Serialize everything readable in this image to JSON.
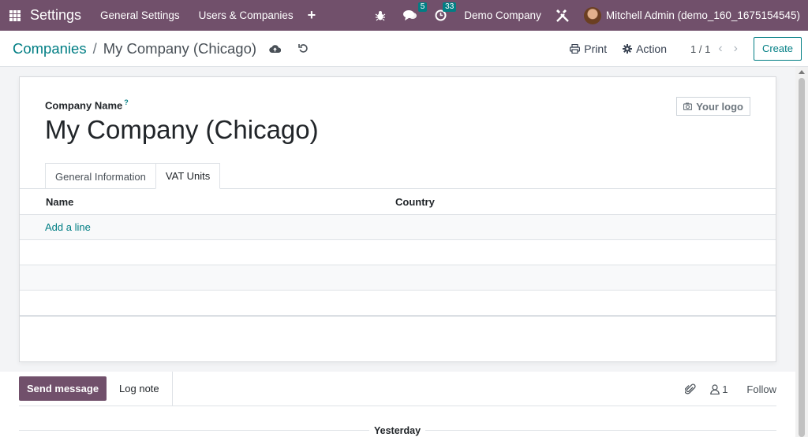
{
  "navbar": {
    "app_name": "Settings",
    "menu": [
      "General Settings",
      "Users & Companies"
    ],
    "plus": "+",
    "messages_count": "5",
    "activities_count": "33",
    "company": "Demo Company",
    "user": "Mitchell Admin (demo_160_1675154545)"
  },
  "control_panel": {
    "breadcrumb_parent": "Companies",
    "breadcrumb_sep": "/",
    "breadcrumb_current": "My Company (Chicago)",
    "print_label": "Print",
    "action_label": "Action",
    "pager": "1 / 1",
    "create_label": "Create"
  },
  "form": {
    "company_name_label": "Company Name",
    "help_mark": "?",
    "company_name": "My Company (Chicago)",
    "logo_label": "Your logo",
    "tabs": [
      "General Information",
      "VAT Units"
    ],
    "active_tab": "VAT Units",
    "columns": [
      "Name",
      "Country"
    ],
    "add_line": "Add a line"
  },
  "chatter": {
    "send_message": "Send message",
    "log_note": "Log note",
    "followers_count": "1",
    "follow": "Follow",
    "day_label": "Yesterday"
  },
  "colors": {
    "navbar": "#71506b",
    "accent": "#017e84"
  }
}
